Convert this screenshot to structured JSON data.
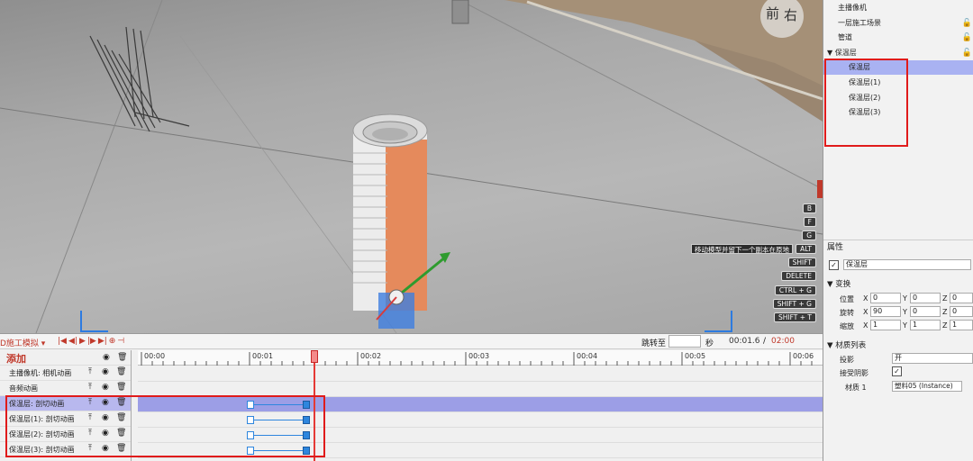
{
  "viewport": {
    "hint": "移动模型并留下一个副本在原地",
    "gizmo": {
      "front": "前",
      "right": "右"
    },
    "keys": [
      "B",
      "F",
      "G",
      "ALT",
      "SHIFT",
      "DELETE",
      "CTRL + G",
      "SHIFT + G",
      "SHIFT + T"
    ]
  },
  "timeline": {
    "mode": "D施工模拟 ▾",
    "controls": [
      "|◀",
      "◀|",
      "▶",
      "|▶",
      "▶|",
      "⊕",
      "⊣"
    ],
    "jump_label": "跳转至",
    "jump_value": "",
    "seconds_label": "秒",
    "current_time": "00:01.6",
    "separator": "/",
    "total_time": "02:00",
    "add_label": "添加",
    "ruler_labels": [
      "00:00",
      "00:01",
      "00:02",
      "00:03",
      "00:04",
      "00:05",
      "00:06"
    ],
    "tracks": [
      {
        "name": "主播像机: 相机动画",
        "selected": false,
        "keyframes": false
      },
      {
        "name": "音频动画",
        "selected": false,
        "keyframes": false
      },
      {
        "name": "保温层: 剖切动画",
        "selected": true,
        "keyframes": true
      },
      {
        "name": "保温层(1): 剖切动画",
        "selected": false,
        "keyframes": true
      },
      {
        "name": "保温层(2): 剖切动画",
        "selected": false,
        "keyframes": true
      },
      {
        "name": "保温层(3): 剖切动画",
        "selected": false,
        "keyframes": true
      }
    ],
    "icons": {
      "top": "top-icon",
      "eye": "eye-icon",
      "trash": "trash-icon"
    }
  },
  "scene": {
    "items": [
      {
        "label": "主播像机",
        "indent": 1,
        "selected": false,
        "lock": false
      },
      {
        "label": "一层施工场景",
        "indent": 1,
        "selected": false,
        "lock": true
      },
      {
        "label": "管道",
        "indent": 1,
        "selected": false,
        "lock": true
      },
      {
        "label": "▼ 保温层",
        "indent": 0,
        "selected": false,
        "lock": true
      },
      {
        "label": "保温层",
        "indent": 2,
        "selected": true,
        "lock": false
      },
      {
        "label": "保温层(1)",
        "indent": 2,
        "selected": false,
        "lock": false
      },
      {
        "label": "保温层(2)",
        "indent": 2,
        "selected": false,
        "lock": false
      },
      {
        "label": "保温层(3)",
        "indent": 2,
        "selected": false,
        "lock": false
      }
    ]
  },
  "properties": {
    "header": "属性",
    "name_value": "保温层",
    "transform_label": "▼ 变换",
    "position_label": "位置",
    "rotation_label": "旋转",
    "scale_label": "缩放",
    "position": {
      "x": "0",
      "y": "0",
      "z": "0"
    },
    "rotation": {
      "x": "90",
      "y": "0",
      "z": "0"
    },
    "scale": {
      "x": "1",
      "y": "1",
      "z": "1"
    },
    "material_label": "▼ 材质列表",
    "shadow_label": "投影",
    "shadow_value": "开",
    "receive_shadow_label": "接受阴影",
    "material1_label": "材质 1",
    "material1_value": "塑料05 (Instance)"
  }
}
